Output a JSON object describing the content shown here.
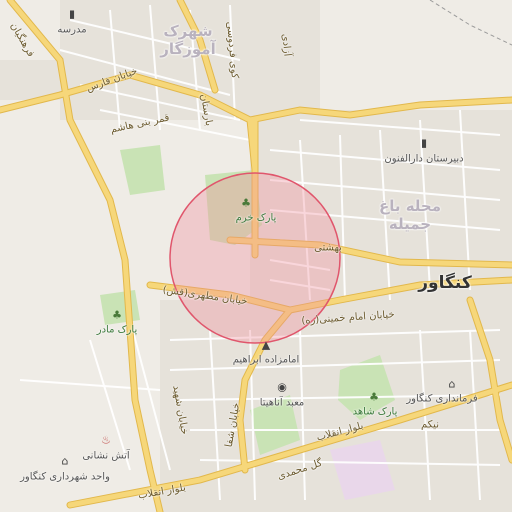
{
  "map": {
    "city": "کنگاور",
    "districts": [
      {
        "id": "d1",
        "text": "شهرک\nآموزگار"
      },
      {
        "id": "d2",
        "text": "محله باغ\nجمیله"
      }
    ],
    "roads": [
      {
        "id": "r1",
        "text": "بهشتی"
      },
      {
        "id": "r2",
        "text": "خیابان مطهری(قش)"
      },
      {
        "id": "r3",
        "text": "خیابان امام خمینی(ره)"
      },
      {
        "id": "r4",
        "text": "بلوار انقلاب"
      },
      {
        "id": "r5",
        "text": "بلوار انقلاب"
      },
      {
        "id": "r6",
        "text": "گل محمدی"
      },
      {
        "id": "r7",
        "text": "فرهنگیان"
      },
      {
        "id": "r8",
        "text": "قمر بنی هاشم"
      },
      {
        "id": "r9",
        "text": "خیابان فارس"
      },
      {
        "id": "r10",
        "text": "خیابان شفا"
      },
      {
        "id": "r11",
        "text": "خیابان شهید"
      },
      {
        "id": "r12",
        "text": "بارستان"
      },
      {
        "id": "r13",
        "text": "نیکم"
      },
      {
        "id": "r14",
        "text": "کوی فردوسی"
      },
      {
        "id": "r15",
        "text": "آزادی"
      }
    ],
    "pois": [
      {
        "id": "p1",
        "text": "مدرسه",
        "icon": "school-icon"
      },
      {
        "id": "p2",
        "text": "دبیرستان دارالفنون",
        "icon": "school-icon"
      },
      {
        "id": "p3",
        "text": "پارک خرم",
        "icon": "tree-icon"
      },
      {
        "id": "p4",
        "text": "پارک مادر",
        "icon": "tree-icon"
      },
      {
        "id": "p5",
        "text": "امامزاده ابراهیم",
        "icon": "shrine-icon"
      },
      {
        "id": "p6",
        "text": "معبد آناهیتا",
        "icon": "camera-icon"
      },
      {
        "id": "p7",
        "text": "پارک شاهد",
        "icon": "tree-icon"
      },
      {
        "id": "p8",
        "text": "فرمانداری کنگاور",
        "icon": "government-icon"
      },
      {
        "id": "p9",
        "text": "آتش نشانی",
        "icon": "fire-icon"
      },
      {
        "id": "p10",
        "text": "واحد شهرداری کنگاور",
        "icon": "government-icon"
      }
    ],
    "colors": {
      "background": "#efece6",
      "major_road": "#f6d77a",
      "major_road_casing": "#e2b84c",
      "minor_road": "#ffffff",
      "park": "#c9e3b5",
      "highlight_fill": "#f28b9a",
      "highlight_stroke": "#e0566c"
    }
  }
}
